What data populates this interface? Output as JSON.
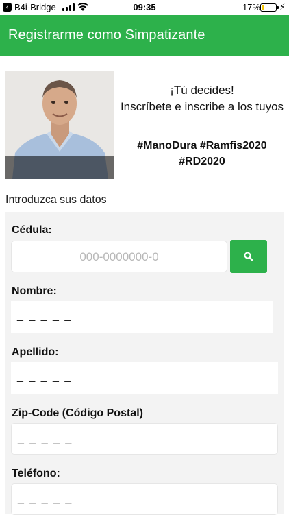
{
  "status_bar": {
    "back_app": "B4i-Bridge",
    "time": "09:35",
    "battery_percent": "17%",
    "battery_level": 0.17
  },
  "app_bar": {
    "title": "Registrarme como Simpatizante"
  },
  "promo": {
    "line1": "¡Tú decides!",
    "line2": "Inscríbete e inscribe a los tuyos",
    "tags_line1": "#ManoDura #Ramfis2020",
    "tags_line2": "#RD2020"
  },
  "form": {
    "intro": "Introduzca sus datos",
    "cedula": {
      "label": "Cédula:",
      "placeholder": "000-0000000-0"
    },
    "nombre": {
      "label": "Nombre:",
      "value": "_ _ _ _ _"
    },
    "apellido": {
      "label": "Apellido:",
      "value": "_ _ _ _ _"
    },
    "zip": {
      "label": "Zip-Code (Código Postal)",
      "value": "_ _ _ _ _"
    },
    "telefono": {
      "label": "Teléfono:",
      "value": "_ _ _ _ _"
    }
  },
  "icons": {
    "search": "search-icon",
    "back": "back-arrow-icon"
  },
  "colors": {
    "primary": "#2db14b",
    "panel": "#f3f3f3"
  }
}
